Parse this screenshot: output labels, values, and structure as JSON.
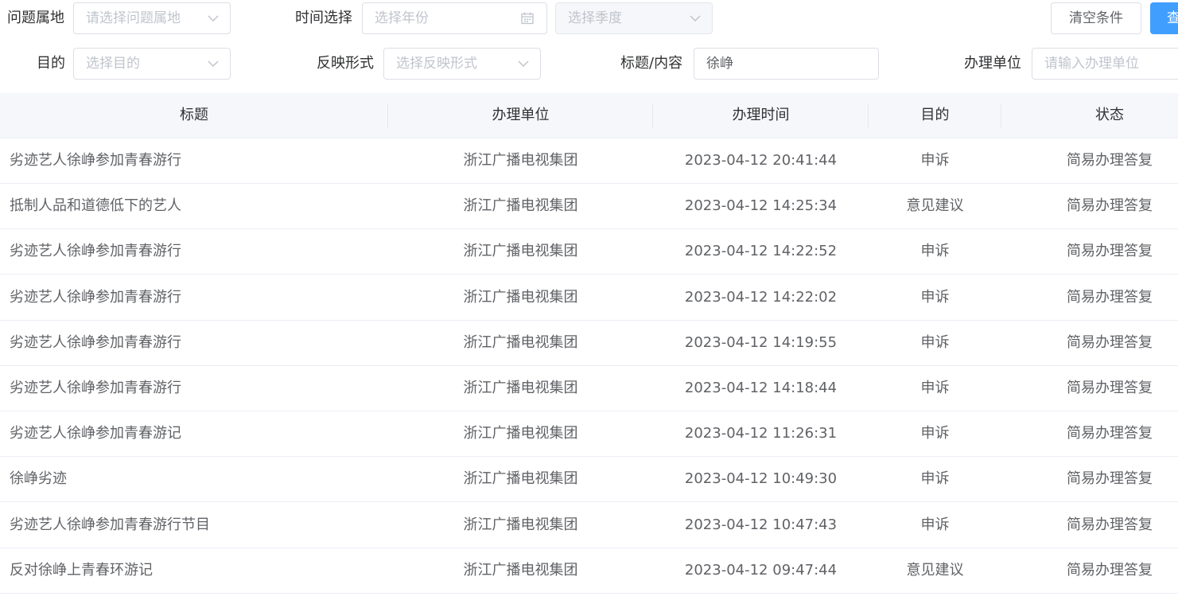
{
  "filters": {
    "region": {
      "label": "问题属地",
      "placeholder": "请选择问题属地"
    },
    "time": {
      "label": "时间选择",
      "year_placeholder": "选择年份",
      "quarter_placeholder": "选择季度"
    },
    "purpose": {
      "label": "目的",
      "placeholder": "选择目的"
    },
    "form": {
      "label": "反映形式",
      "placeholder": "选择反映形式"
    },
    "keyword": {
      "label": "标题/内容",
      "value": "徐峥"
    },
    "unit": {
      "label": "办理单位",
      "placeholder": "请输入办理单位"
    }
  },
  "buttons": {
    "clear": "清空条件",
    "search": "查"
  },
  "table": {
    "columns": [
      "标题",
      "办理单位",
      "办理时间",
      "目的",
      "状态"
    ],
    "rows": [
      [
        "劣迹艺人徐峥参加青春游行",
        "浙江广播电视集团",
        "2023-04-12 20:41:44",
        "申诉",
        "简易办理答复"
      ],
      [
        "抵制人品和道德低下的艺人",
        "浙江广播电视集团",
        "2023-04-12 14:25:34",
        "意见建议",
        "简易办理答复"
      ],
      [
        "劣迹艺人徐峥参加青春游行",
        "浙江广播电视集团",
        "2023-04-12 14:22:52",
        "申诉",
        "简易办理答复"
      ],
      [
        "劣迹艺人徐峥参加青春游行",
        "浙江广播电视集团",
        "2023-04-12 14:22:02",
        "申诉",
        "简易办理答复"
      ],
      [
        "劣迹艺人徐峥参加青春游行",
        "浙江广播电视集团",
        "2023-04-12 14:19:55",
        "申诉",
        "简易办理答复"
      ],
      [
        "劣迹艺人徐峥参加青春游行",
        "浙江广播电视集团",
        "2023-04-12 14:18:44",
        "申诉",
        "简易办理答复"
      ],
      [
        "劣迹艺人徐峥参加青春游记",
        "浙江广播电视集团",
        "2023-04-12 11:26:31",
        "申诉",
        "简易办理答复"
      ],
      [
        "徐峥劣迹",
        "浙江广播电视集团",
        "2023-04-12 10:49:30",
        "申诉",
        "简易办理答复"
      ],
      [
        "劣迹艺人徐峥参加青春游行节目",
        "浙江广播电视集团",
        "2023-04-12 10:47:43",
        "申诉",
        "简易办理答复"
      ],
      [
        "反对徐峥上青春环游记",
        "浙江广播电视集团",
        "2023-04-12 09:47:44",
        "意见建议",
        "简易办理答复"
      ]
    ]
  },
  "colors": {
    "primary": "#409eff",
    "border": "#dcdfe6",
    "header_bg": "#f5f7fa",
    "text": "#606266"
  },
  "icons": {
    "dropdown": "chevron-down-icon",
    "date": "calendar-icon"
  }
}
